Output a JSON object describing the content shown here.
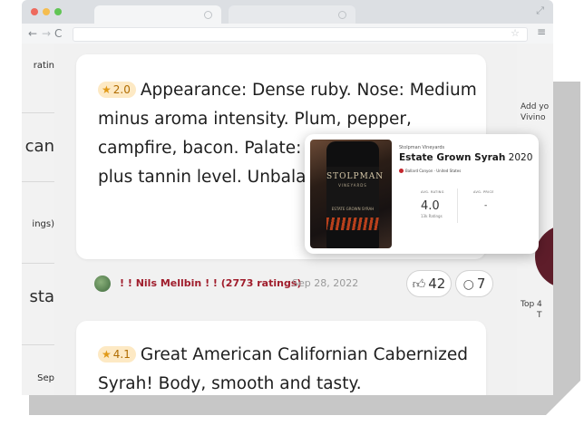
{
  "browser": {
    "nav": {
      "back_icon": "←",
      "forward_icon": "→",
      "reload_icon": "C",
      "star_icon": "☆",
      "menu_icon": "≡"
    }
  },
  "left_sidebar": {
    "items": [
      {
        "label": "ratin"
      },
      {
        "label": "can"
      },
      {
        "label": "ings)"
      },
      {
        "label": "sta"
      },
      {
        "label": "Sep"
      }
    ]
  },
  "right_sidebar": {
    "promo_line1": "Add yo",
    "promo_line2": "Vivino",
    "top_line1": "Top 4",
    "top_line2": "T"
  },
  "reviews": [
    {
      "rating": "2.0",
      "text": "Appearance: Dense ruby. Nose: Medium minus aroma intensity. Plum, pepper, campfire, bacon. Palate: Dry. Medium minus plus tannin level. Unbalanced in my opinion.",
      "reviewer": "! ! Nils Mellbin ! ! (2773 ratings)",
      "date": "Sep 28, 2022",
      "likes": "42",
      "comments": "7"
    },
    {
      "rating": "4.1",
      "text": "Great American Californian Cabernized Syrah! Body, smooth and tasty."
    }
  ],
  "wine_popup": {
    "winery": "Stolpman Vineyards",
    "name_bold": "Estate Grown Syrah",
    "vintage": "2020",
    "region": "Ballard Canyon · United States",
    "avg_rating_label": "AVG. RATING",
    "avg_rating": "4.0",
    "ratings_count": "13k Ratings",
    "avg_price_label": "AVG. PRICE",
    "avg_price": "-",
    "bottle_brand": "STOLPMAN",
    "bottle_sub": "VINEYARDS",
    "bottle_mid": "ESTATE GROWN SYRAH"
  },
  "colors": {
    "reviewer": "#a01d2c",
    "badge_bg": "#fde9c4",
    "badge_star": "#e19a18"
  }
}
